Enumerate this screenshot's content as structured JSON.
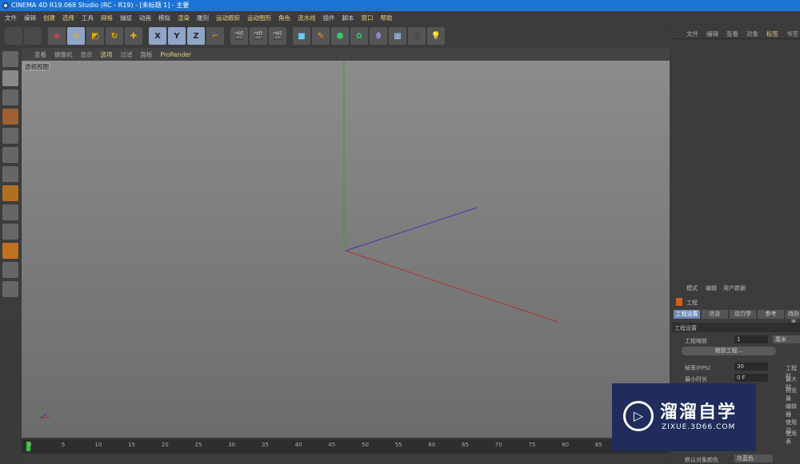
{
  "title": "CINEMA 4D R19.068 Studio (RC - R19) - [未标题 1] - 主要",
  "menu": [
    "文件",
    "编辑",
    "创建",
    "选择",
    "工具",
    "网格",
    "捕捉",
    "动画",
    "模拟",
    "渲染",
    "雕刻",
    "运动跟踪",
    "运动图形",
    "角色",
    "流水线",
    "插件",
    "脚本",
    "窗口",
    "帮助"
  ],
  "toolbar": {
    "x": "X",
    "y": "Y",
    "z": "Z"
  },
  "viewport": {
    "menu": [
      "查看",
      "摄像机",
      "显示",
      "选项",
      "过滤",
      "面板",
      "ProRender"
    ],
    "label": "透视视图"
  },
  "timeline": {
    "ticks": [
      "0",
      "5",
      "10",
      "15",
      "20",
      "25",
      "30",
      "35",
      "40",
      "45",
      "50",
      "55",
      "60",
      "65",
      "70",
      "75",
      "80",
      "85"
    ]
  },
  "object_manager": {
    "tabs": [
      "文件",
      "编辑",
      "查看",
      "对象",
      "标签",
      "书签"
    ]
  },
  "attributes": {
    "tabs": [
      "模式",
      "编辑",
      "用户数据"
    ],
    "object": "工程",
    "subtabs": [
      "工程设置",
      "信息",
      "动力学",
      "参考",
      "待办事"
    ],
    "section": "工程设置",
    "scale_label": "工程缩放",
    "scale_value": "1",
    "scale_unit": "厘米",
    "scale_button": "缩放工程...",
    "fps_label": "帧率(FPS)",
    "fps_value": "30",
    "min_time_label": "最小时长",
    "min_time_value": "0 F",
    "right_labels": [
      "工程时",
      "最大时",
      "预览最",
      "编辑器",
      "使用动",
      "使用表"
    ],
    "default_color_label": "默认对象颜色",
    "default_color_value": "灰蓝色"
  },
  "watermark": {
    "title": "溜溜自学",
    "url": "ZIXUE.3D66.COM"
  }
}
